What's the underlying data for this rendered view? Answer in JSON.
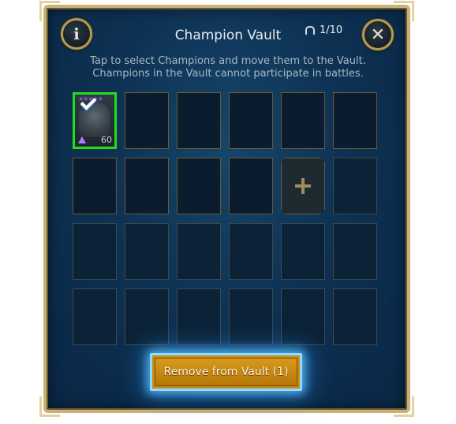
{
  "dialog": {
    "title": "Champion Vault",
    "capacity": "1/10",
    "instructions": [
      "Tap to select Champions and move them to the Vault.",
      "Champions in the Vault cannot participate in battles."
    ],
    "info_icon": "i",
    "close_icon": "x"
  },
  "grid": {
    "columns": 6,
    "rows": 4,
    "slots": [
      {
        "type": "champion",
        "level": "60",
        "selected": true,
        "stars": "★★★★★"
      },
      {
        "type": "empty"
      },
      {
        "type": "empty"
      },
      {
        "type": "empty"
      },
      {
        "type": "empty"
      },
      {
        "type": "empty"
      },
      {
        "type": "empty"
      },
      {
        "type": "empty"
      },
      {
        "type": "empty"
      },
      {
        "type": "empty"
      },
      {
        "type": "add"
      },
      {
        "type": "locked"
      },
      {
        "type": "locked"
      },
      {
        "type": "locked"
      },
      {
        "type": "locked"
      },
      {
        "type": "locked"
      },
      {
        "type": "locked"
      },
      {
        "type": "locked"
      },
      {
        "type": "locked"
      },
      {
        "type": "locked"
      },
      {
        "type": "locked"
      },
      {
        "type": "locked"
      },
      {
        "type": "locked"
      },
      {
        "type": "locked"
      }
    ]
  },
  "actions": {
    "remove_label": "Remove from Vault (1)"
  },
  "colors": {
    "panel": "#0e3254",
    "frame_gold": "#c9b27a",
    "selected_border": "#22dd1b",
    "button_gold": "#c88a12",
    "button_glow": "#5abeff"
  }
}
